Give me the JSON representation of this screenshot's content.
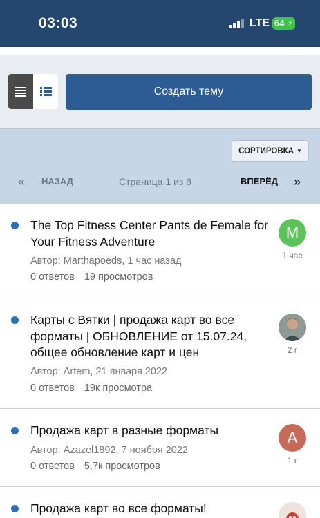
{
  "status_bar": {
    "time": "03:03",
    "network": "LTE",
    "battery": "64"
  },
  "toolbar": {
    "create_label": "Создать тему"
  },
  "pager": {
    "sort_label": "СОРТИРОВКА",
    "prev_arrow": "«",
    "prev_label": "НАЗАД",
    "page_info": "Страница 1 из 8",
    "next_label": "ВПЕРЁД",
    "next_arrow": "»"
  },
  "topics": [
    {
      "title": "The Top Fitness Center Pants de Female for Your Fitness Adventure",
      "author": "Автор: Marthapoeds, 1 час назад",
      "replies": "0 ответов",
      "views": "19 просмотров",
      "avatar_letter": "M",
      "avatar_color": "#5cc35a",
      "ago": "1 час"
    },
    {
      "title": "Карты с Вятки | продажа карт во все форматы | ОБНОВЛЕНИЕ от 15.07.24, общее обновление карт и цен",
      "author": "Автор: Artem, 21 января 2022",
      "replies": "0 ответов",
      "views": "19к просмотра",
      "avatar_letter": "",
      "avatar_color": "#7d8a86",
      "ago": "2 г"
    },
    {
      "title": "Продажа карт в разные форматы",
      "author": "Автор: Azazel1892, 7 ноября 2022",
      "replies": "0 ответов",
      "views": "5,7к просмотров",
      "avatar_letter": "A",
      "avatar_color": "#c86a5a",
      "ago": "1 г"
    },
    {
      "title": "Продажа карт во все форматы!",
      "author": "",
      "replies": "",
      "views": "",
      "avatar_letter": "",
      "avatar_color": "#e6d7d0",
      "ago": ""
    }
  ]
}
